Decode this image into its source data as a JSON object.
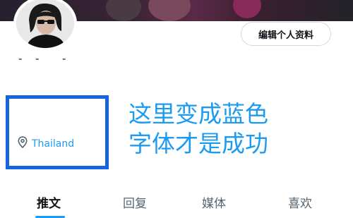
{
  "profile": {
    "edit_button_label": "编辑个人资料",
    "display_name_separator": "-",
    "location": "Thailand",
    "location_icon": "map-pin-icon"
  },
  "annotation": {
    "line1": "这里变成蓝色",
    "line2": "字体才是成功"
  },
  "tabs": [
    {
      "label": "推文",
      "active": true
    },
    {
      "label": "回复",
      "active": false
    },
    {
      "label": "媒体",
      "active": false
    },
    {
      "label": "喜欢",
      "active": false
    }
  ],
  "colors": {
    "link_blue": "#1d9bf0",
    "highlight_box": "#1565e0",
    "text_primary": "#0f1419",
    "text_secondary": "#536471"
  }
}
